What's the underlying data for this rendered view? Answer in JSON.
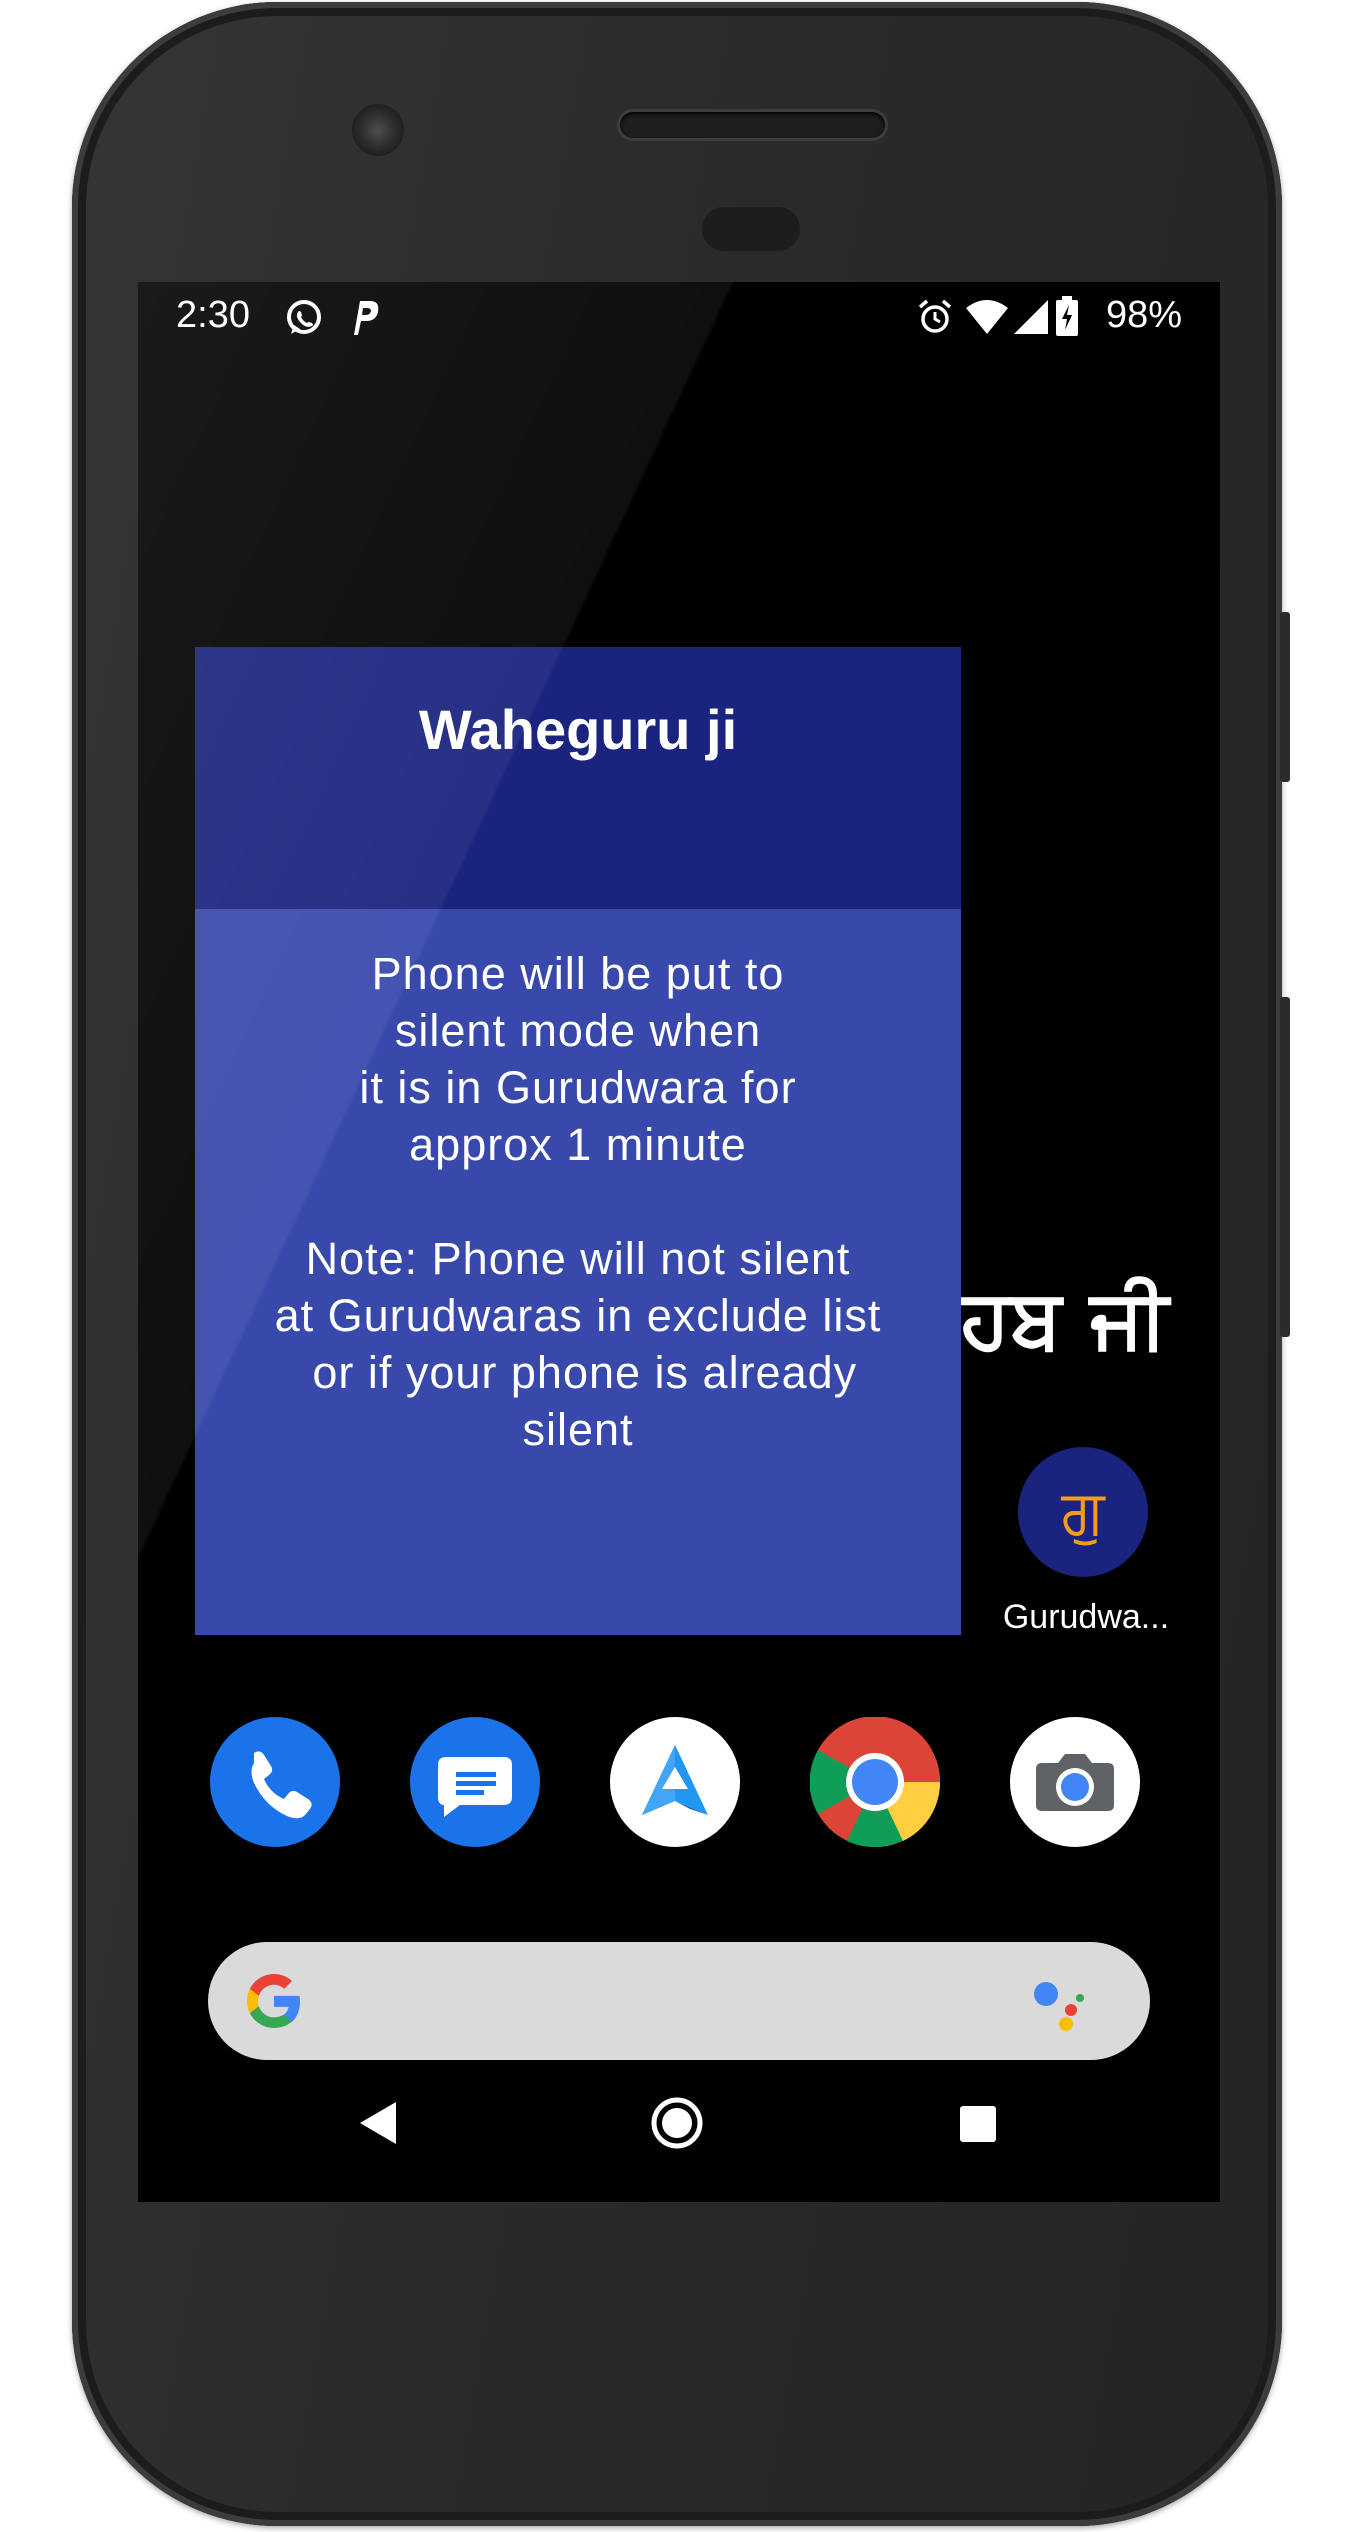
{
  "status_bar": {
    "time": "2:30",
    "battery": "98%",
    "left_icons": [
      "whatsapp-icon",
      "parking-icon"
    ],
    "right_icons": [
      "alarm-icon",
      "wifi-icon",
      "signal-icon",
      "battery-charging-icon"
    ]
  },
  "dialog": {
    "title": "Waheguru ji",
    "body_lines": [
      "Phone will be put to",
      "silent mode when",
      "it is in Gurudwara for",
      "approx 1 minute"
    ],
    "note_lines": [
      "Note: Phone will not silent",
      "at Gurudwaras in exclude list",
      " or if your phone is already",
      "silent"
    ],
    "header_color": "#1a237e",
    "body_color": "#3949ab"
  },
  "homescreen": {
    "widget_text": "ਹਬ ਜੀ",
    "app_icon_glyph": "ਗੁ",
    "app_label": "Gurudwa..."
  },
  "dock": {
    "apps": [
      "phone-icon",
      "messages-icon",
      "android-auto-icon",
      "chrome-icon",
      "camera-icon"
    ]
  },
  "search": {
    "icons": [
      "google-g-icon",
      "google-assistant-icon"
    ]
  },
  "nav_bar": {
    "buttons": [
      "back-icon",
      "home-icon",
      "recents-icon"
    ]
  }
}
